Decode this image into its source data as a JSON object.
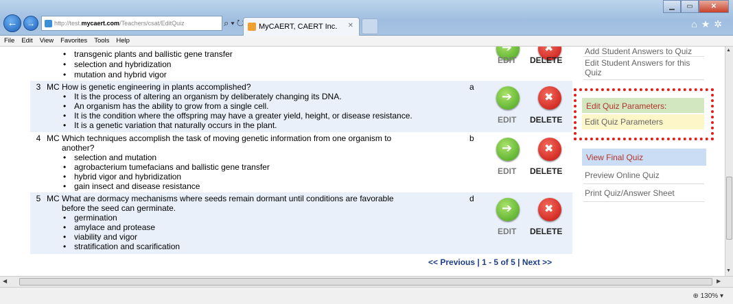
{
  "browser": {
    "url_prefix": "http://test.",
    "url_domain": "mycaert.com",
    "url_path": "/Teachers/csat/EditQuiz",
    "tab_title": "MyCAERT, CAERT Inc.",
    "zoom": "130%"
  },
  "menu": [
    "File",
    "Edit",
    "View",
    "Favorites",
    "Tools",
    "Help"
  ],
  "questions": [
    {
      "number": "",
      "type": "",
      "text": "",
      "answer": "",
      "options": [
        "transgenic plants and ballistic gene transfer",
        "selection and hybridization",
        "mutation and hybrid vigor"
      ]
    },
    {
      "number": "3",
      "type": "MC",
      "text": "How is genetic engineering in plants accomplished?",
      "answer": "a",
      "options": [
        "It is the process of altering an organism by deliberately changing its DNA.",
        "An organism has the ability to grow from a single cell.",
        "It is the condition where the offspring may have a greater yield, height, or disease resistance.",
        "It is a genetic variation that naturally occurs in the plant."
      ]
    },
    {
      "number": "4",
      "type": "MC",
      "text": "Which techniques accomplish the task of moving genetic information from one organism to",
      "text2": "another?",
      "answer": "b",
      "options": [
        "selection and mutation",
        "agrobacterium tumefacians and ballistic gene transfer",
        "hybrid vigor and hybridization",
        "gain insect and disease resistance"
      ]
    },
    {
      "number": "5",
      "type": "MC",
      "text": "What are dormacy mechanisms where seeds remain dormant until conditions are favorable",
      "text2": "before the seed can germinate.",
      "answer": "d",
      "options": [
        "germination",
        "amylace and protease",
        "viability and vigor",
        "stratification and scarification"
      ]
    }
  ],
  "actions": {
    "edit": "EDIT",
    "delete": "DELETE"
  },
  "pager": {
    "prev": "<< Previous",
    "range": "1 - 5 of 5",
    "next": "Next >>",
    "sep": "|"
  },
  "panel": {
    "add_answers": "Add Student Answers to Quiz",
    "edit_answers_1": "Edit Student Answers for this",
    "edit_answers_2": "Quiz",
    "params_header": "Edit Quiz Parameters:",
    "params_link": "Edit Quiz Parameters",
    "view_final": "View Final Quiz",
    "preview": "Preview Online Quiz",
    "print": "Print Quiz/Answer Sheet"
  },
  "colors": {
    "highlight_border": "#e21b1b",
    "accent_text": "#b3342b",
    "row_alt": "#e9f0fa"
  }
}
